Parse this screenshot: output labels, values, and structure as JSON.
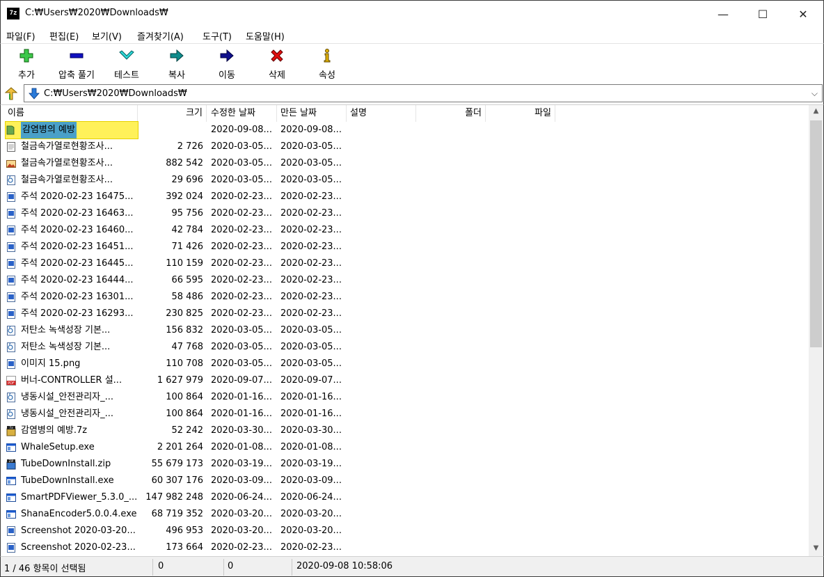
{
  "window": {
    "title": "C:₩Users₩2020₩Downloads₩",
    "app_icon_text": "7z",
    "minimize_glyph": "—",
    "maximize_glyph": "☐",
    "close_glyph": "✕"
  },
  "menu": [
    "파일(F)",
    "편집(E)",
    "보기(V)",
    "즐겨찾기(A)",
    "도구(T)",
    "도움말(H)"
  ],
  "toolbar": [
    {
      "label": "추가",
      "icon": "plus-icon",
      "color": "#22b14c"
    },
    {
      "label": "압축 풀기",
      "icon": "minus-icon",
      "color": "#0000a0"
    },
    {
      "label": "테스트",
      "icon": "check-chevron-icon",
      "color": "#00c0c0"
    },
    {
      "label": "복사",
      "icon": "copy-arrow-icon",
      "color": "#008080"
    },
    {
      "label": "이동",
      "icon": "move-arrow-icon",
      "color": "#000080"
    },
    {
      "label": "삭제",
      "icon": "delete-x-icon",
      "color": "#e00000"
    },
    {
      "label": "속성",
      "icon": "info-icon",
      "color": "#d4a000"
    }
  ],
  "address": {
    "path": "C:₩Users₩2020₩Downloads₩",
    "dropdown_glyph": "⌵"
  },
  "columns": {
    "name": "이름",
    "size": "크기",
    "modified": "수정한 날짜",
    "created": "만든 날짜",
    "comment": "설명",
    "folders": "폴더",
    "files": "파일"
  },
  "files": [
    {
      "name": "감염병의 예방",
      "size": "",
      "modified": "2020-09-08...",
      "created": "2020-09-08...",
      "icon": "folder-icon",
      "selected": true
    },
    {
      "name": "철금속가열로현황조사...",
      "size": "2 726",
      "modified": "2020-03-05...",
      "created": "2020-03-05...",
      "icon": "text-file-icon"
    },
    {
      "name": "철금속가열로현황조사...",
      "size": "882 542",
      "modified": "2020-03-05...",
      "created": "2020-03-05...",
      "icon": "image-file-icon"
    },
    {
      "name": "철금속가열로현황조사...",
      "size": "29 696",
      "modified": "2020-03-05...",
      "created": "2020-03-05...",
      "icon": "doc-file-icon"
    },
    {
      "name": "주석 2020-02-23 16475...",
      "size": "392 024",
      "modified": "2020-02-23...",
      "created": "2020-02-23...",
      "icon": "png-file-icon"
    },
    {
      "name": "주석 2020-02-23 16463...",
      "size": "95 756",
      "modified": "2020-02-23...",
      "created": "2020-02-23...",
      "icon": "png-file-icon"
    },
    {
      "name": "주석 2020-02-23 16460...",
      "size": "42 784",
      "modified": "2020-02-23...",
      "created": "2020-02-23...",
      "icon": "png-file-icon"
    },
    {
      "name": "주석 2020-02-23 16451...",
      "size": "71 426",
      "modified": "2020-02-23...",
      "created": "2020-02-23...",
      "icon": "png-file-icon"
    },
    {
      "name": "주석 2020-02-23 16445...",
      "size": "110 159",
      "modified": "2020-02-23...",
      "created": "2020-02-23...",
      "icon": "png-file-icon"
    },
    {
      "name": "주석 2020-02-23 16444...",
      "size": "66 595",
      "modified": "2020-02-23...",
      "created": "2020-02-23...",
      "icon": "png-file-icon"
    },
    {
      "name": "주석 2020-02-23 16301...",
      "size": "58 486",
      "modified": "2020-02-23...",
      "created": "2020-02-23...",
      "icon": "png-file-icon"
    },
    {
      "name": "주석 2020-02-23 16293...",
      "size": "230 825",
      "modified": "2020-02-23...",
      "created": "2020-02-23...",
      "icon": "png-file-icon"
    },
    {
      "name": "저탄소 녹색성장 기본...",
      "size": "156 832",
      "modified": "2020-03-05...",
      "created": "2020-03-05...",
      "icon": "doc-file-icon"
    },
    {
      "name": "저탄소 녹색성장 기본...",
      "size": "47 768",
      "modified": "2020-03-05...",
      "created": "2020-03-05...",
      "icon": "doc-file-icon"
    },
    {
      "name": "이미지 15.png",
      "size": "110 708",
      "modified": "2020-03-05...",
      "created": "2020-03-05...",
      "icon": "png-file-icon"
    },
    {
      "name": "버너-CONTROLLER 설...",
      "size": "1 627 979",
      "modified": "2020-09-07...",
      "created": "2020-09-07...",
      "icon": "pdf-file-icon"
    },
    {
      "name": "냉동시설_안전관리자_...",
      "size": "100 864",
      "modified": "2020-01-16...",
      "created": "2020-01-16...",
      "icon": "doc-file-icon"
    },
    {
      "name": "냉동시설_안전관리자_...",
      "size": "100 864",
      "modified": "2020-01-16...",
      "created": "2020-01-16...",
      "icon": "doc-file-icon"
    },
    {
      "name": "감염병의 예방.7z",
      "size": "52 242",
      "modified": "2020-03-30...",
      "created": "2020-03-30...",
      "icon": "7z-archive-icon"
    },
    {
      "name": "WhaleSetup.exe",
      "size": "2 201 264",
      "modified": "2020-01-08...",
      "created": "2020-01-08...",
      "icon": "exe-file-icon"
    },
    {
      "name": "TubeDownInstall.zip",
      "size": "55 679 173",
      "modified": "2020-03-19...",
      "created": "2020-03-19...",
      "icon": "zip-archive-icon"
    },
    {
      "name": "TubeDownInstall.exe",
      "size": "60 307 176",
      "modified": "2020-03-09...",
      "created": "2020-03-09...",
      "icon": "exe-file-icon"
    },
    {
      "name": "SmartPDFViewer_5.3.0_...",
      "size": "147 982 248",
      "modified": "2020-06-24...",
      "created": "2020-06-24...",
      "icon": "exe-file-icon"
    },
    {
      "name": "ShanaEncoder5.0.0.4.exe",
      "size": "68 719 352",
      "modified": "2020-03-20...",
      "created": "2020-03-20...",
      "icon": "exe-file-icon"
    },
    {
      "name": "Screenshot 2020-03-20...",
      "size": "496 953",
      "modified": "2020-03-20...",
      "created": "2020-03-20...",
      "icon": "png-file-icon"
    },
    {
      "name": "Screenshot 2020-02-23...",
      "size": "173 664",
      "modified": "2020-02-23...",
      "created": "2020-02-23...",
      "icon": "png-file-icon"
    }
  ],
  "status": {
    "selection": "1 / 46 항목이 선택됨",
    "size1": "0",
    "size2": "0",
    "datetime": "2020-09-08 10:58:06"
  },
  "scrollbar": {
    "up_glyph": "▲",
    "down_glyph": "▼"
  },
  "colors": {
    "selection_highlight": "#fff159",
    "selected_name_bg": "#4aa0c8",
    "folder": "#6aa84f"
  }
}
